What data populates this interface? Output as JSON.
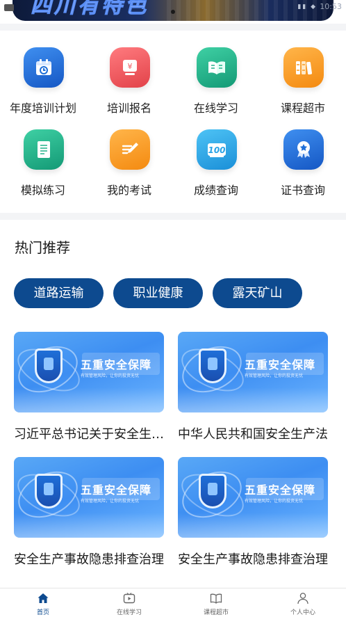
{
  "banner": {
    "title": "四川有特色",
    "time": "10:53"
  },
  "grid": [
    {
      "label": "年度培训计划",
      "icon": "calendar-icon",
      "color": "#1f6fd8"
    },
    {
      "label": "培训报名",
      "icon": "yuan-register-icon",
      "color": "#ef5a5f"
    },
    {
      "label": "在线学习",
      "icon": "open-book-icon",
      "color": "#22b28a"
    },
    {
      "label": "课程超市",
      "icon": "books-shelf-icon",
      "color": "#f89a1e"
    },
    {
      "label": "模拟练习",
      "icon": "document-icon",
      "color": "#22b28a"
    },
    {
      "label": "我的考试",
      "icon": "pencil-edit-icon",
      "color": "#f89a1e"
    },
    {
      "label": "成绩查询",
      "icon": "score-100-icon",
      "color": "#29a3e6"
    },
    {
      "label": "证书查询",
      "icon": "certificate-badge-icon",
      "color": "#1f6fd8"
    }
  ],
  "hot": {
    "title": "热门推荐",
    "chips": [
      "道路运输",
      "职业健康",
      "露天矿山"
    ],
    "cards": [
      {
        "banner": "五重安全保障",
        "banner_sub": "有效管理风险，让你的投资无忧",
        "title": "习近平总书记关于安全生产重要论述"
      },
      {
        "banner": "五重安全保障",
        "banner_sub": "有效管理风险，让你的投资无忧",
        "title": "中华人民共和国安全生产法"
      },
      {
        "banner": "五重安全保障",
        "banner_sub": "有效管理风险，让你的投资无忧",
        "title": "安全生产事故隐患排查治理"
      },
      {
        "banner": "五重安全保障",
        "banner_sub": "有效管理风险，让你的投资无忧",
        "title": "安全生产事故隐患排查治理"
      }
    ]
  },
  "tabbar": [
    {
      "label": "首页",
      "icon": "home-icon",
      "active": true
    },
    {
      "label": "在线学习",
      "icon": "video-play-icon",
      "active": false
    },
    {
      "label": "课程超市",
      "icon": "book-icon",
      "active": false
    },
    {
      "label": "个人中心",
      "icon": "person-icon",
      "active": false
    }
  ],
  "colors": {
    "primary": "#0d4a8f",
    "background_gap": "#f3f4f6"
  }
}
